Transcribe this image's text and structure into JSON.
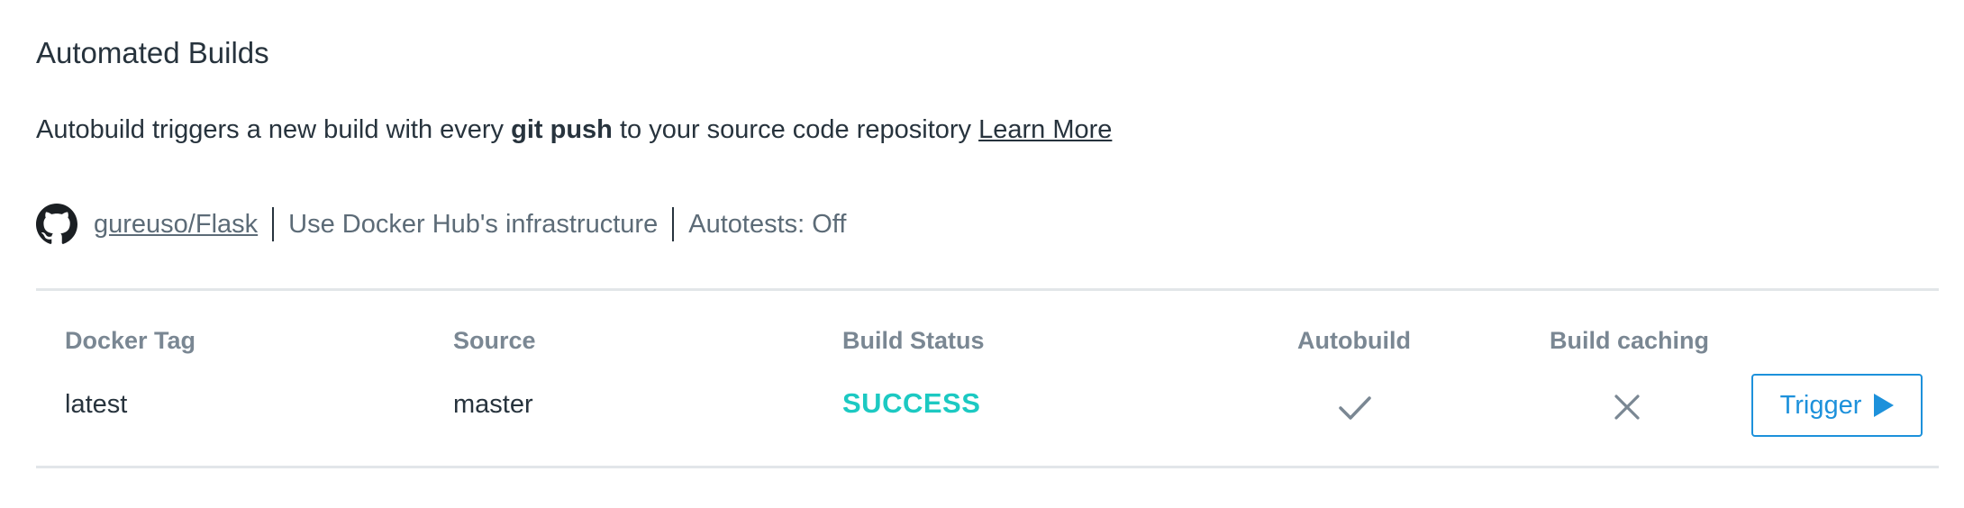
{
  "section": {
    "title": "Automated Builds"
  },
  "description": {
    "prefix": "Autobuild triggers a new build with every ",
    "bold": "git push",
    "suffix": " to your source code repository ",
    "link": "Learn More"
  },
  "source_info": {
    "icon": "github-icon",
    "repo": "gureuso/Flask",
    "infrastructure": "Use Docker Hub's infrastructure",
    "autotests": "Autotests: Off"
  },
  "table": {
    "headers": {
      "docker_tag": "Docker Tag",
      "source": "Source",
      "build_status": "Build Status",
      "autobuild": "Autobuild",
      "build_caching": "Build caching"
    },
    "rows": [
      {
        "docker_tag": "latest",
        "source": "master",
        "build_status": "SUCCESS",
        "autobuild": true,
        "autobuild_icon": "checkmark-icon",
        "build_caching": false,
        "build_caching_icon": "close-icon",
        "action_label": "Trigger",
        "action_icon": "play-icon"
      }
    ]
  },
  "colors": {
    "success": "#1cc9c2",
    "accent": "#1d91db",
    "text": "#27333d",
    "muted": "#7a8793",
    "divider": "#e2e6e9"
  }
}
